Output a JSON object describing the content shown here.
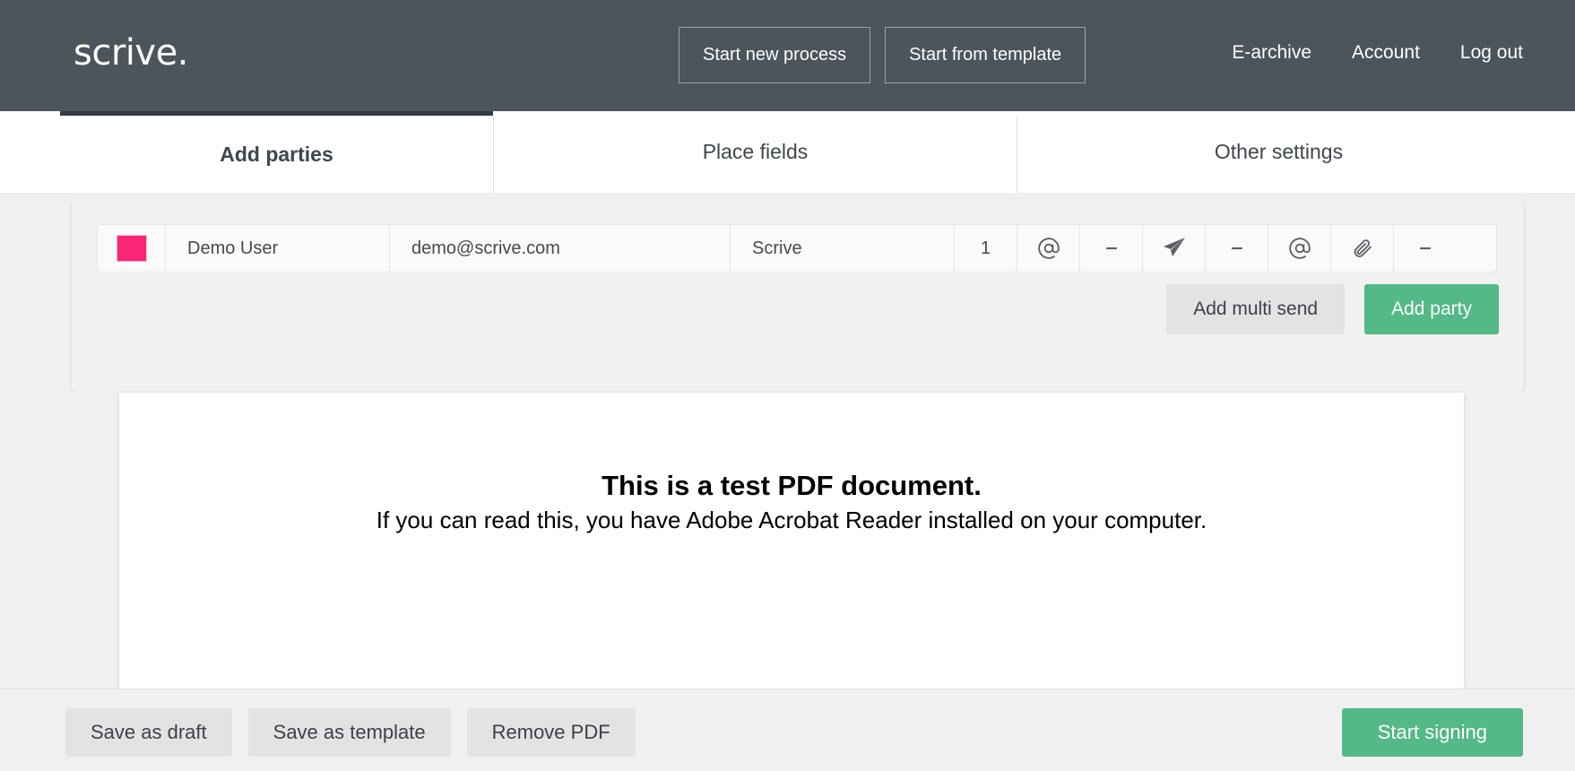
{
  "header": {
    "logo": "scrive.",
    "buttons": [
      {
        "label": "Start new process",
        "name": "start-new-process-button"
      },
      {
        "label": "Start from template",
        "name": "start-from-template-button"
      }
    ],
    "links": [
      {
        "label": "E-archive"
      },
      {
        "label": "Account"
      },
      {
        "label": "Log out"
      }
    ]
  },
  "tabs": [
    {
      "label": "Add parties",
      "active": true
    },
    {
      "label": "Place fields",
      "active": false
    },
    {
      "label": "Other settings",
      "active": false
    }
  ],
  "parties": {
    "row": {
      "color": "#fb2576",
      "name": "Demo User",
      "email": "demo@scrive.com",
      "company": "Scrive",
      "order": "1",
      "icons": [
        {
          "glyph": "@",
          "name": "at-sign-icon-delivery"
        },
        {
          "glyph": "-",
          "name": "dash-icon-1"
        },
        {
          "glyph": "paper-plane",
          "name": "paper-plane-icon"
        },
        {
          "glyph": "-",
          "name": "dash-icon-2"
        },
        {
          "glyph": "@",
          "name": "at-sign-icon-confirmation"
        },
        {
          "glyph": "paperclip",
          "name": "paperclip-icon"
        },
        {
          "glyph": "-",
          "name": "dash-icon-3"
        }
      ]
    },
    "buttons": {
      "add_multi_send": "Add multi send",
      "add_party": "Add party"
    }
  },
  "document": {
    "line1": "This is a test PDF document.",
    "line2": "If you can read this, you have Adobe Acrobat Reader installed on your computer."
  },
  "bottombar": {
    "save_draft": "Save as draft",
    "save_template": "Save as template",
    "remove_pdf": "Remove PDF",
    "start_signing": "Start signing"
  },
  "colors": {
    "header_bg": "#4c545c",
    "accent_green": "#53b987",
    "party_pink": "#fb2576",
    "tab_active_border": "#333b42"
  }
}
